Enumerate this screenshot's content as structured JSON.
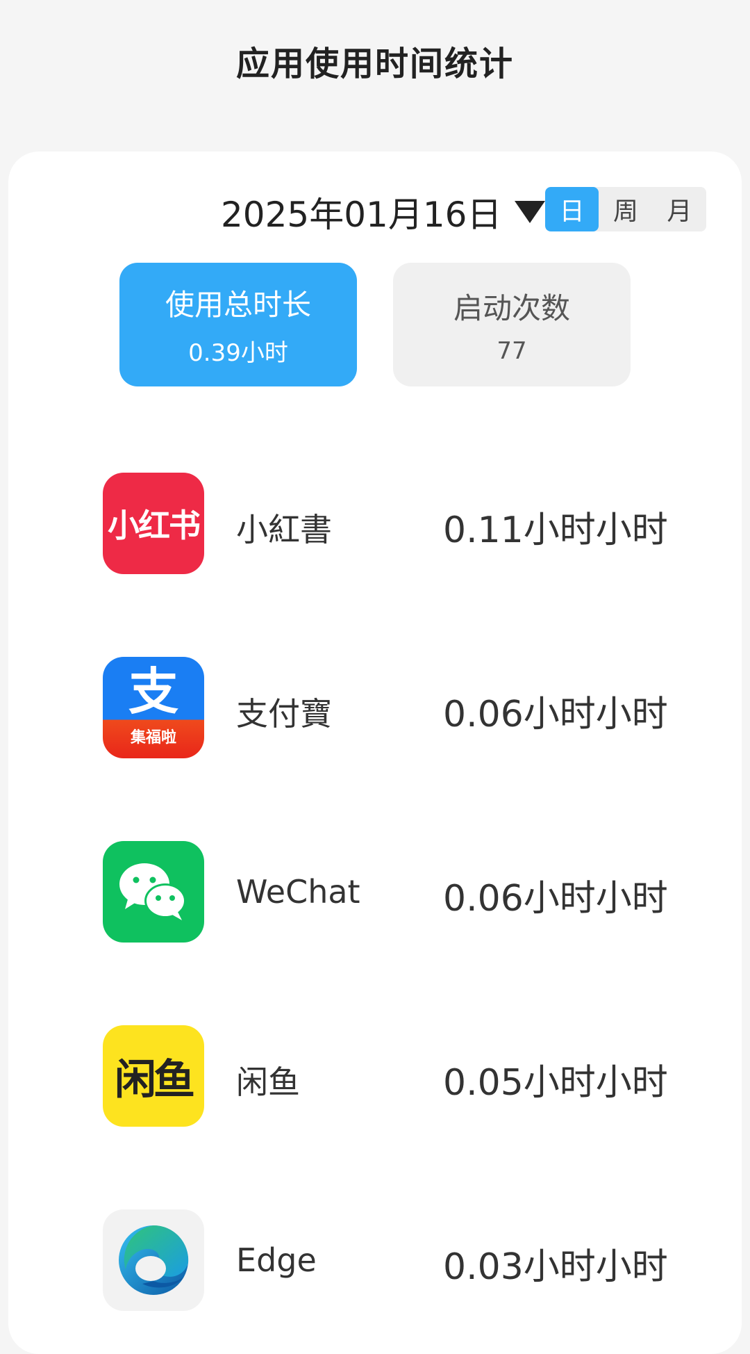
{
  "header": {
    "title": "应用使用时间统计"
  },
  "date_picker": {
    "date": "2025年01月16日",
    "icon": "caret-down-icon"
  },
  "period_tabs": [
    {
      "label": "日",
      "active": true
    },
    {
      "label": "周",
      "active": false
    },
    {
      "label": "月",
      "active": false
    }
  ],
  "stats": {
    "total_usage": {
      "label": "使用总时长",
      "value": "0.39小时"
    },
    "launch_count": {
      "label": "启动次数",
      "value": "77"
    }
  },
  "colors": {
    "accent": "#33aaf7",
    "background": "#f5f5f5",
    "card": "#ffffff"
  },
  "apps": [
    {
      "name": "小紅書",
      "time": "0.11小时小时",
      "icon": "xiaohongshu-icon",
      "icon_text": "小红书"
    },
    {
      "name": "支付寶",
      "time": "0.06小时小时",
      "icon": "alipay-icon",
      "icon_text": "支",
      "icon_subtext": "集福啦"
    },
    {
      "name": "WeChat",
      "time": "0.06小时小时",
      "icon": "wechat-icon"
    },
    {
      "name": "闲鱼",
      "time": "0.05小时小时",
      "icon": "xianyu-icon",
      "icon_text": "闲鱼"
    },
    {
      "name": "Edge",
      "time": "0.03小时小时",
      "icon": "edge-icon"
    }
  ]
}
